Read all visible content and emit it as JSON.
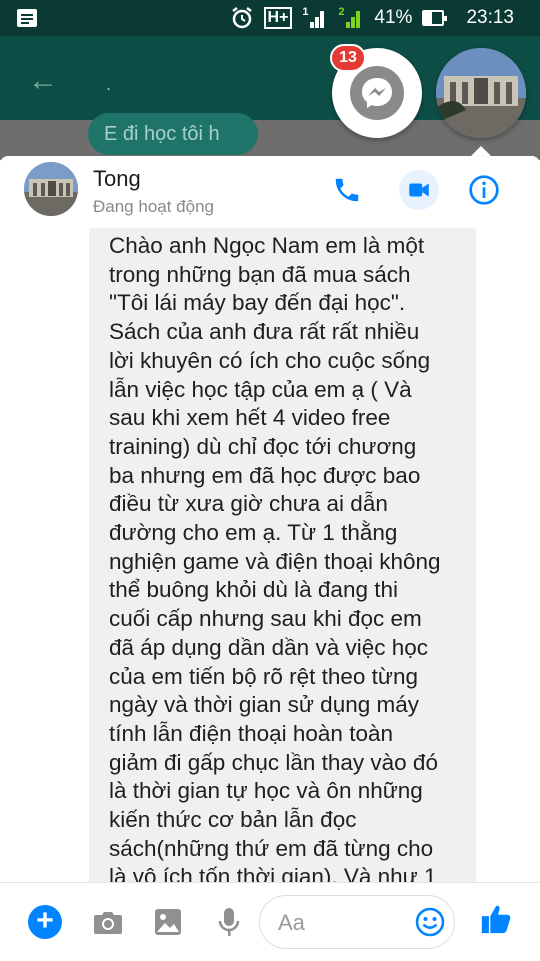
{
  "status_bar": {
    "network_label": "H+",
    "battery_percent": "41%",
    "battery_level": 0.41,
    "time": "23:13",
    "sim1_label": "1",
    "sim2_label": "2"
  },
  "background_app": {
    "title": ".",
    "bubble_text": "E đi học tôi h"
  },
  "chat_heads": {
    "unread_badge": "13",
    "messenger_icon": "messenger-bolt-icon"
  },
  "conversation": {
    "contact_name": "Tong",
    "contact_status": "Đang hoạt động",
    "accent_color": "#0084ff"
  },
  "message": {
    "lines": [
      "Chào anh Ngọc Nam em là một",
      "trong những bạn đã mua sách",
      "\"Tôi lái máy bay đến đại học\".",
      "Sách của anh đưa rất rất nhiều",
      "lời khuyên có ích cho cuộc sống",
      "lẫn việc học tập của em ạ ( Và",
      "sau khi xem hết 4 video free",
      "training) dù chỉ đọc tới chương",
      "ba nhưng em đã học được bao",
      "điều từ xưa giờ chưa ai dẫn",
      "đường cho em ạ. Từ 1 thằng",
      "nghiện game và điện thoại không",
      "thể buông khỏi dù là đang thi",
      "cuối cấp nhưng sau khi đọc em",
      "đã áp dụng dần dần và việc học",
      "của em tiến bộ rõ rệt theo từng",
      "ngày và thời gian sử dụng máy",
      "tính lẫn điện thoại hoàn toàn",
      "giảm đi gấp chục lần thay vào đó",
      "là thời gian tự học và ôn những",
      "kiến thức cơ bản lẫn đọc",
      "sách(những thứ em đã từng cho",
      "là vô ích tốn thời gian). Và như 1"
    ]
  },
  "composer": {
    "placeholder": "Aa"
  }
}
